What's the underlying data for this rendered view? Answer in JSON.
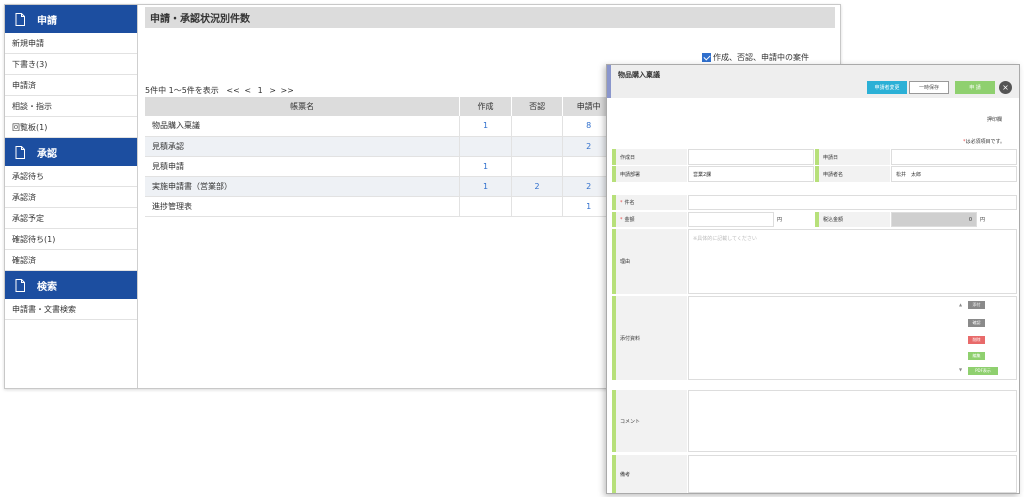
{
  "sidebar": {
    "sections": [
      {
        "title": "申請",
        "icon": "document-icon",
        "items": [
          "新規申請",
          "下書き(3)",
          "申請済",
          "相談・指示",
          "回覧板(1)"
        ]
      },
      {
        "title": "承認",
        "icon": "document-icon",
        "items": [
          "承認待ち",
          "承認済",
          "承認予定",
          "確認待ち(1)",
          "確認済"
        ]
      },
      {
        "title": "検索",
        "icon": "document-icon",
        "items": [
          "申請書・文書検索"
        ]
      }
    ]
  },
  "content": {
    "title": "申請・承認状況別件数",
    "filter_label": "作成、否認、申請中の案件",
    "pager": {
      "summary": "5件中 1～5件を表示",
      "first": "<<",
      "prev": "<",
      "page": "1",
      "next": ">",
      "last": ">>"
    },
    "table": {
      "headers": [
        "帳票名",
        "作成",
        "否認",
        "申請中"
      ],
      "rows": [
        [
          "物品購入稟議",
          "1",
          "",
          "8"
        ],
        [
          "見積承認",
          "",
          "",
          "2"
        ],
        [
          "見積申請",
          "1",
          "",
          ""
        ],
        [
          "実施申請書（営業部）",
          "1",
          "2",
          "2"
        ],
        [
          "進捗管理表",
          "",
          "",
          "1"
        ]
      ]
    }
  },
  "dialog": {
    "title": "物品購入稟議",
    "buttons": {
      "history": "申請者変更",
      "temp_save": "一時保存",
      "apply": "申 請",
      "close": "×"
    },
    "seal": "押印欄",
    "required_mark": "*",
    "required_note": "は必須項目です。",
    "fields": {
      "created_date": "作成日",
      "apply_date": "申請日",
      "apply_dept": "申請部署",
      "apply_dept_value": "営業2課",
      "applicant": "申請者名",
      "applicant_value": "松井　太郎",
      "subject": "件名",
      "amount": "金額",
      "yen": "円",
      "tax_amount": "税込金額",
      "tax_value": "0",
      "reason": "理由",
      "reason_placeholder": "※具体的に記載してください",
      "attachments": "添付資料",
      "comment": "コメント",
      "remarks": "備考"
    },
    "attach_buttons": [
      {
        "label": "添付",
        "color": "#8a8a8a"
      },
      {
        "label": "確認",
        "color": "#8a8a8a"
      },
      {
        "label": "削除",
        "color": "#e86a6a"
      },
      {
        "label": "編集",
        "color": "#8fd06f"
      },
      {
        "label": "PDF表示",
        "color": "#8fd06f"
      }
    ],
    "scroll": {
      "up": "▲",
      "down": "▼"
    }
  },
  "colors": {
    "sidebar_head": "#1c4ea0",
    "link": "#2f6fcd",
    "accent_green": "#8fd06f",
    "accent_cyan": "#2bb0d6"
  }
}
